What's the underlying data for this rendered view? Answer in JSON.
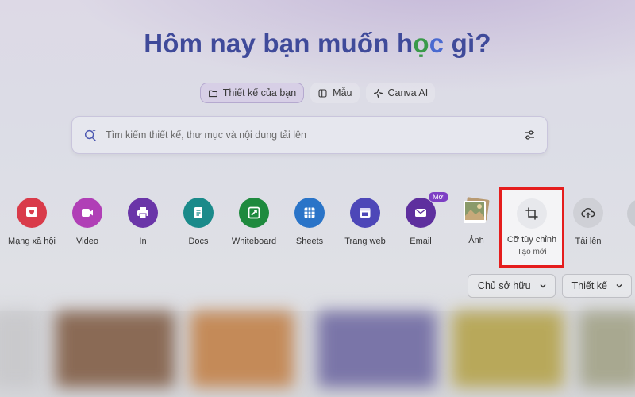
{
  "headline": {
    "prefix": "Hôm nay bạn muốn ",
    "letters": [
      {
        "char": "h",
        "color": "#3f4a9a"
      },
      {
        "char": "ọ",
        "color": "#3a9a4a"
      },
      {
        "char": "c",
        "color": "#4a6ad0"
      }
    ],
    "suffix": " gì?"
  },
  "tabs": [
    {
      "label": "Thiết kế của bạn",
      "icon": "folder-icon",
      "active": true
    },
    {
      "label": "Mẫu",
      "icon": "template-icon",
      "active": false
    },
    {
      "label": "Canva AI",
      "icon": "sparkle-icon",
      "active": false
    }
  ],
  "search": {
    "placeholder": "Tìm kiếm thiết kế, thư mục và nội dung tải lên"
  },
  "categories": [
    {
      "label": "Mạng xã hội",
      "icon": "heart-icon",
      "color": "#d93b4a"
    },
    {
      "label": "Video",
      "icon": "video-icon",
      "color": "#b03fb6"
    },
    {
      "label": "In",
      "icon": "printer-icon",
      "color": "#6a35a8"
    },
    {
      "label": "Docs",
      "icon": "docs-icon",
      "color": "#1a8a8a"
    },
    {
      "label": "Whiteboard",
      "icon": "whiteboard-icon",
      "color": "#1e8a3e"
    },
    {
      "label": "Sheets",
      "icon": "sheets-icon",
      "color": "#2a74c8"
    },
    {
      "label": "Trang web",
      "icon": "website-icon",
      "color": "#4d47b8"
    },
    {
      "label": "Email",
      "icon": "email-icon",
      "color": "#5e2f9e",
      "badge": "Mới"
    },
    {
      "label": "Ảnh",
      "icon": "photo-icon",
      "color": "#9a8a6a"
    }
  ],
  "custom_size": {
    "label": "Cỡ tùy chỉnh",
    "sub": "Tạo mới",
    "icon": "custom-size-icon",
    "highlight_color": "#e51d1d"
  },
  "upload": {
    "label": "Tải lên",
    "icon": "upload-cloud-icon"
  },
  "filters": {
    "owner": "Chủ sở hữu",
    "design": "Thiết kế"
  },
  "colors": {
    "accent": "#7d3fc4",
    "headline": "#3f4a9a"
  }
}
